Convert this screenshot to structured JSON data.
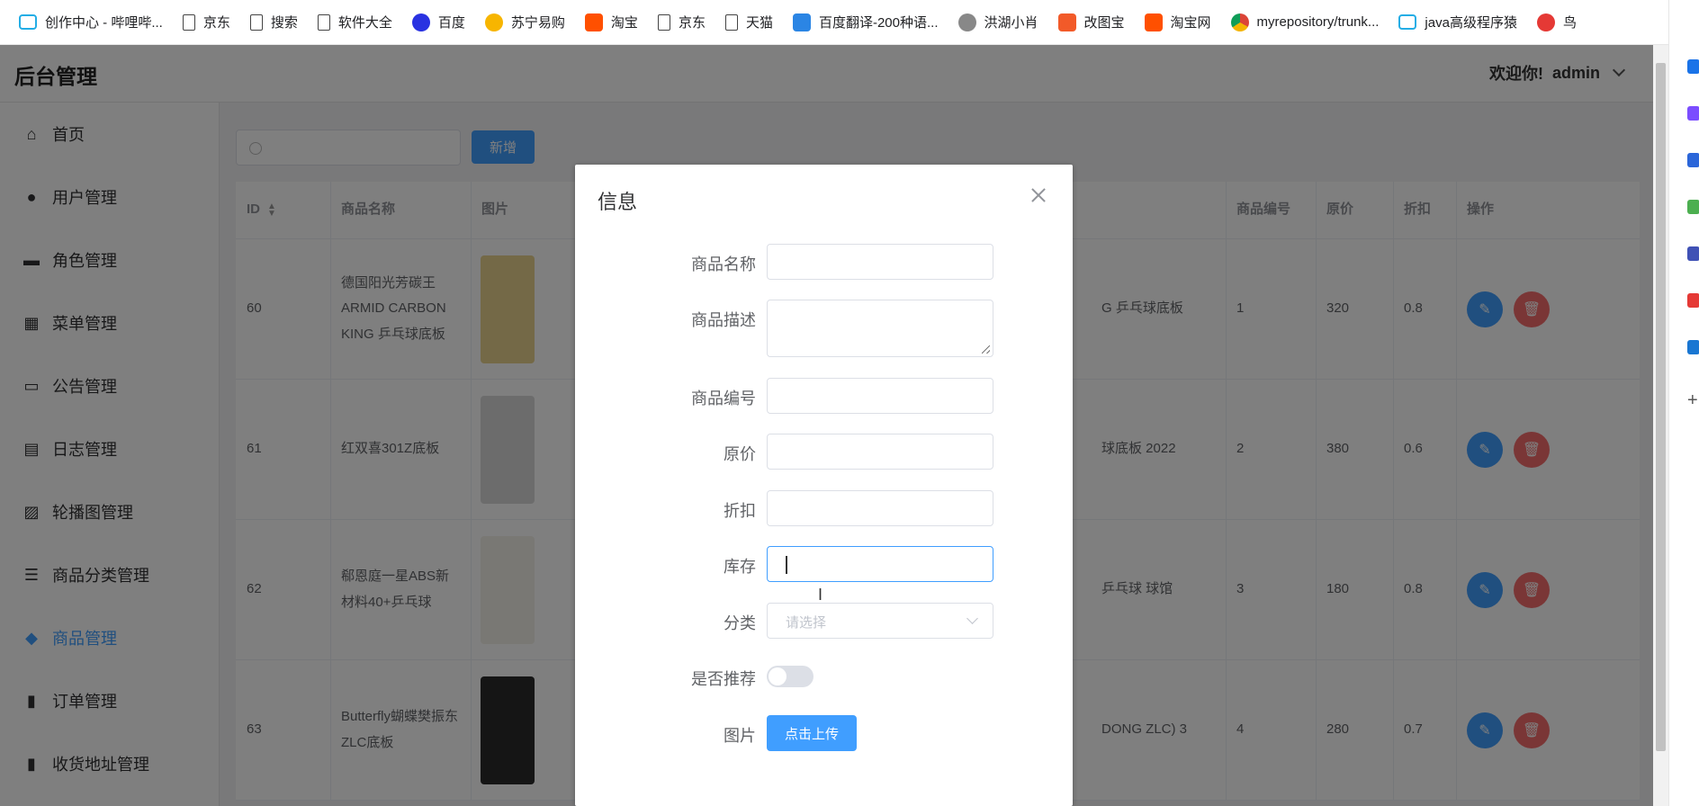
{
  "bookmarks": [
    {
      "label": "创作中心 - 哔哩哔...",
      "icon": "bilibili-icon"
    },
    {
      "label": "京东",
      "icon": "page-icon"
    },
    {
      "label": "搜索",
      "icon": "page-icon"
    },
    {
      "label": "软件大全",
      "icon": "page-icon"
    },
    {
      "label": "百度",
      "icon": "baidu-icon"
    },
    {
      "label": "苏宁易购",
      "icon": "suning-icon"
    },
    {
      "label": "淘宝",
      "icon": "taobao-icon"
    },
    {
      "label": "京东",
      "icon": "page-icon"
    },
    {
      "label": "天猫",
      "icon": "page-icon"
    },
    {
      "label": "百度翻译-200种语...",
      "icon": "translate-icon"
    },
    {
      "label": "洪湖小肖",
      "icon": "hong-icon"
    },
    {
      "label": "改图宝",
      "icon": "gaitubao-icon"
    },
    {
      "label": "淘宝网",
      "icon": "taobao-icon"
    },
    {
      "label": "myrepository/trunk...",
      "icon": "chrome-icon"
    },
    {
      "label": "java高级程序猿",
      "icon": "bilibili-icon"
    },
    {
      "label": "鸟",
      "icon": "bird-icon"
    }
  ],
  "header": {
    "brand": "后台管理",
    "welcome": "欢迎你!",
    "user": "admin"
  },
  "sidebar": {
    "items": [
      {
        "label": "首页",
        "icon": "home-icon"
      },
      {
        "label": "用户管理",
        "icon": "user-icon"
      },
      {
        "label": "角色管理",
        "icon": "briefcase-icon"
      },
      {
        "label": "菜单管理",
        "icon": "grid-icon"
      },
      {
        "label": "公告管理",
        "icon": "board-icon"
      },
      {
        "label": "日志管理",
        "icon": "log-icon"
      },
      {
        "label": "轮播图管理",
        "icon": "image-icon"
      },
      {
        "label": "商品分类管理",
        "icon": "list-icon"
      },
      {
        "label": "商品管理",
        "icon": "bag-icon",
        "active": true
      },
      {
        "label": "订单管理",
        "icon": "bar-chart-icon"
      },
      {
        "label": "收货地址管理",
        "icon": "bar-chart-icon"
      }
    ]
  },
  "toolbar": {
    "add_label": "新增"
  },
  "table": {
    "headers": {
      "id": "ID",
      "name": "商品名称",
      "image": "图片",
      "code": "商品编号",
      "price": "原价",
      "discount": "折扣",
      "ops": "操作"
    },
    "rows": [
      {
        "id": "60",
        "name": "德国阳光芳碳王ARMID CARBON KING 乒乓球底板",
        "desc": "G 乒乓球底板",
        "code": "1",
        "price": "320",
        "discount": "0.8"
      },
      {
        "id": "61",
        "name": "红双喜301Z底板",
        "desc": "球底板 2022",
        "code": "2",
        "price": "380",
        "discount": "0.6"
      },
      {
        "id": "62",
        "name": "郗恩庭一星ABS新材料40+乒乓球",
        "desc": "乒乓球 球馆",
        "code": "3",
        "price": "180",
        "discount": "0.8"
      },
      {
        "id": "63",
        "name": "Butterfly蝴蝶樊振东ZLC底板",
        "desc": "DONG ZLC) 3",
        "code": "4",
        "price": "280",
        "discount": "0.7"
      }
    ]
  },
  "dialog": {
    "title": "信息",
    "fields": {
      "name": "商品名称",
      "desc": "商品描述",
      "code": "商品编号",
      "price": "原价",
      "discount": "折扣",
      "stock": "库存",
      "category": "分类",
      "recommend": "是否推荐",
      "image": "图片"
    },
    "category_placeholder": "请选择",
    "upload_label": "点击上传"
  }
}
